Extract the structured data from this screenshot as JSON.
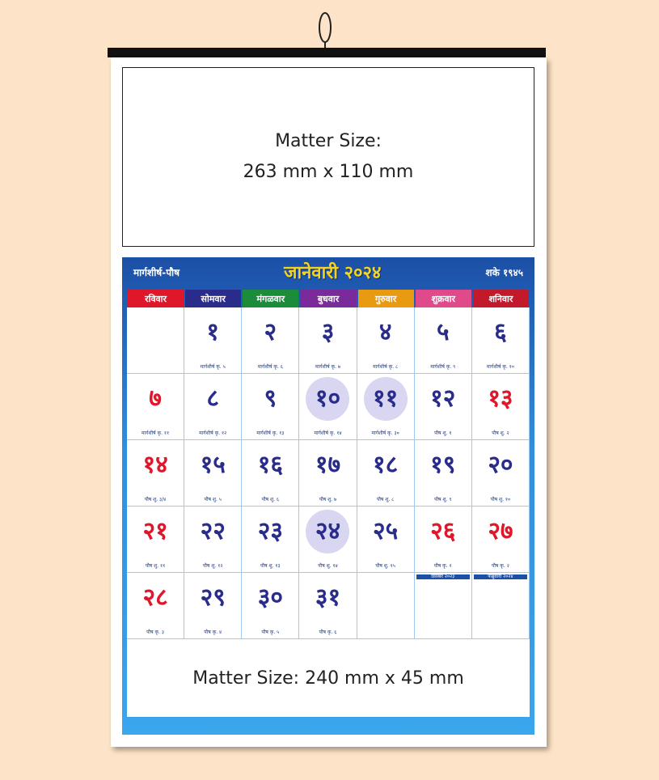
{
  "top_matter": {
    "line1": "Matter Size:",
    "line2": "263 mm x 110 mm"
  },
  "header": {
    "left": "मार्गशीर्ष-पौष",
    "center": "जानेवारी २०२४",
    "right": "शके १९४५"
  },
  "days": [
    {
      "label": "रविवार",
      "color": "#e0162b"
    },
    {
      "label": "सोमवार",
      "color": "#2a2c8c"
    },
    {
      "label": "मंगळवार",
      "color": "#1a8c3a"
    },
    {
      "label": "बुधवार",
      "color": "#7a2a9a"
    },
    {
      "label": "गुरुवार",
      "color": "#e89a10"
    },
    {
      "label": "शुक्रवार",
      "color": "#e04a8a"
    },
    {
      "label": "शनिवार",
      "color": "#c21a2a"
    }
  ],
  "cells": [
    {
      "n": "",
      "red": false,
      "t": ""
    },
    {
      "n": "१",
      "red": false,
      "t": "मार्गशीर्ष कृ. ५"
    },
    {
      "n": "२",
      "red": false,
      "t": "मार्गशीर्ष कृ. ६"
    },
    {
      "n": "३",
      "red": false,
      "t": "मार्गशीर्ष कृ. ७"
    },
    {
      "n": "४",
      "red": false,
      "t": "मार्गशीर्ष कृ. ८"
    },
    {
      "n": "५",
      "red": false,
      "t": "मार्गशीर्ष कृ. ९"
    },
    {
      "n": "६",
      "red": false,
      "t": "मार्गशीर्ष कृ. १०"
    },
    {
      "n": "७",
      "red": true,
      "t": "मार्गशीर्ष कृ. ११"
    },
    {
      "n": "८",
      "red": false,
      "t": "मार्गशीर्ष कृ. १२"
    },
    {
      "n": "९",
      "red": false,
      "t": "मार्गशीर्ष कृ. १३"
    },
    {
      "n": "१०",
      "red": false,
      "t": "मार्गशीर्ष कृ. १४",
      "hl": true
    },
    {
      "n": "११",
      "red": false,
      "t": "मार्गशीर्ष कृ. ३०",
      "hl": true
    },
    {
      "n": "१२",
      "red": false,
      "t": "पौष शु. १"
    },
    {
      "n": "१३",
      "red": true,
      "t": "पौष शु. २"
    },
    {
      "n": "१४",
      "red": true,
      "t": "पौष शु. ३/४"
    },
    {
      "n": "१५",
      "red": false,
      "t": "पौष शु. ५"
    },
    {
      "n": "१६",
      "red": false,
      "t": "पौष शु. ६"
    },
    {
      "n": "१७",
      "red": false,
      "t": "पौष शु. ७"
    },
    {
      "n": "१८",
      "red": false,
      "t": "पौष शु. ८"
    },
    {
      "n": "१९",
      "red": false,
      "t": "पौष शु. ९"
    },
    {
      "n": "२०",
      "red": false,
      "t": "पौष शु. १०"
    },
    {
      "n": "२१",
      "red": true,
      "t": "पौष शु. ११"
    },
    {
      "n": "२२",
      "red": false,
      "t": "पौष शु. १२"
    },
    {
      "n": "२३",
      "red": false,
      "t": "पौष शु. १३"
    },
    {
      "n": "२४",
      "red": false,
      "t": "पौष शु. १४",
      "hl": true
    },
    {
      "n": "२५",
      "red": false,
      "t": "पौष शु. १५"
    },
    {
      "n": "२६",
      "red": true,
      "t": "पौष कृ. १"
    },
    {
      "n": "२७",
      "red": true,
      "t": "पौष कृ. २"
    },
    {
      "n": "२८",
      "red": true,
      "t": "पौष कृ. ३"
    },
    {
      "n": "२९",
      "red": false,
      "t": "पौष कृ. ४"
    },
    {
      "n": "३०",
      "red": false,
      "t": "पौष कृ. ५"
    },
    {
      "n": "३१",
      "red": false,
      "t": "पौष कृ. ६"
    },
    {
      "n": "",
      "red": false,
      "t": ""
    },
    {
      "n": "",
      "red": false,
      "t": "",
      "mini": "डिसेंबर २०२३"
    },
    {
      "n": "",
      "red": false,
      "t": "",
      "mini": "फेब्रुवारी २०२४"
    }
  ],
  "bottom_matter": "Matter Size: 240 mm x 45 mm"
}
